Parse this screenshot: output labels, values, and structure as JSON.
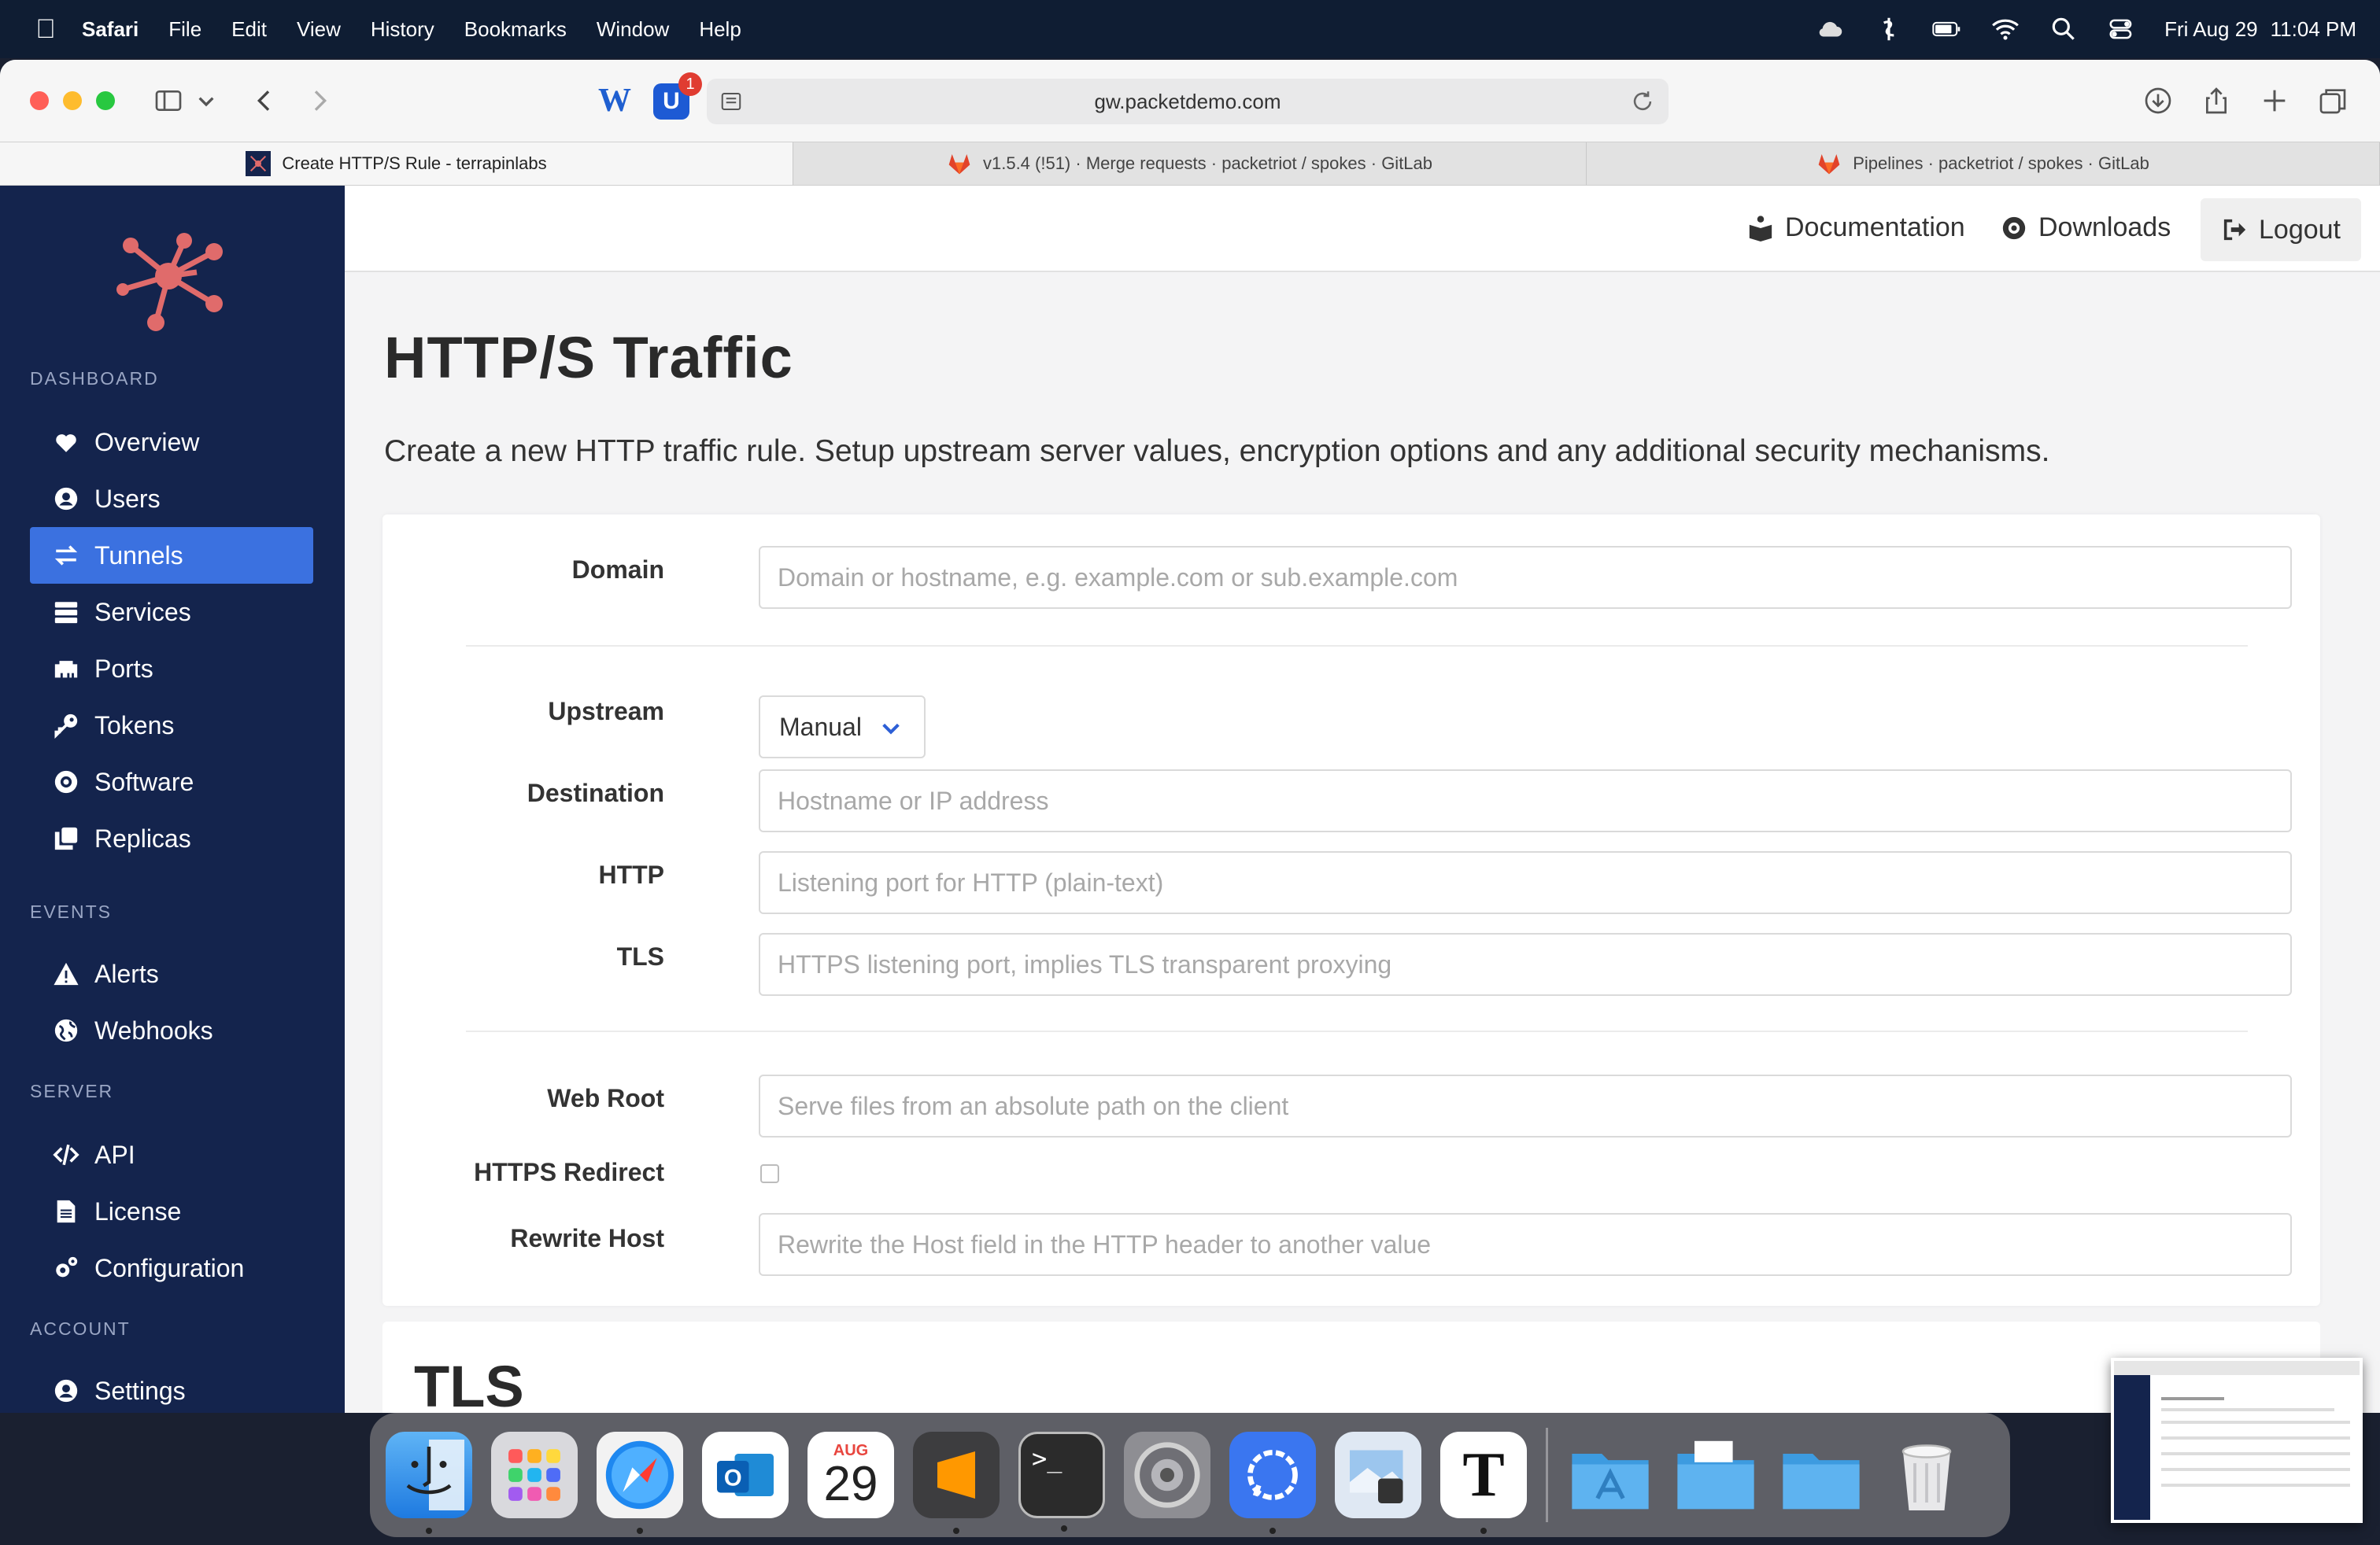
{
  "menubar": {
    "app_name": "Safari",
    "items": [
      "File",
      "Edit",
      "View",
      "History",
      "Bookmarks",
      "Window",
      "Help"
    ],
    "date": "Fri Aug 29",
    "time": "11:04 PM"
  },
  "browser": {
    "url": "gw.packetdemo.com",
    "extension_badge": "1",
    "extension_w": "W",
    "extension_b": "U",
    "tabs": [
      {
        "title": "Create HTTP/S Rule - terrapinlabs",
        "active": true
      },
      {
        "title": "v1.5.4 (!51) · Merge requests · packetriot / spokes · GitLab",
        "active": false
      },
      {
        "title": "Pipelines · packetriot / spokes · GitLab",
        "active": false
      }
    ]
  },
  "sidebar": {
    "sections": {
      "dashboard": "DASHBOARD",
      "events": "EVENTS",
      "server": "SERVER",
      "account": "ACCOUNT"
    },
    "items": [
      {
        "label": "Overview",
        "icon": "heartbeat-icon"
      },
      {
        "label": "Users",
        "icon": "user-circle-icon"
      },
      {
        "label": "Tunnels",
        "icon": "exchange-icon",
        "active": true
      },
      {
        "label": "Services",
        "icon": "server-icon"
      },
      {
        "label": "Ports",
        "icon": "ethernet-icon"
      },
      {
        "label": "Tokens",
        "icon": "key-icon"
      },
      {
        "label": "Software",
        "icon": "disc-icon"
      },
      {
        "label": "Replicas",
        "icon": "clone-icon"
      },
      {
        "label": "Alerts",
        "icon": "warning-icon"
      },
      {
        "label": "Webhooks",
        "icon": "globe-icon"
      },
      {
        "label": "API",
        "icon": "code-icon"
      },
      {
        "label": "License",
        "icon": "file-icon"
      },
      {
        "label": "Configuration",
        "icon": "gears-icon"
      },
      {
        "label": "Settings",
        "icon": "user-circle-icon"
      }
    ]
  },
  "topnav": {
    "documentation": "Documentation",
    "downloads": "Downloads",
    "logout": "Logout"
  },
  "page": {
    "title": "HTTP/S Traffic",
    "description": "Create a new HTTP traffic rule. Setup upstream server values, encryption options and any additional security mechanisms."
  },
  "form": {
    "domain": {
      "label": "Domain",
      "placeholder": "Domain or hostname, e.g. example.com or sub.example.com",
      "value": ""
    },
    "upstream": {
      "label": "Upstream",
      "value": "Manual"
    },
    "destination": {
      "label": "Destination",
      "placeholder": "Hostname or IP address",
      "value": ""
    },
    "http": {
      "label": "HTTP",
      "placeholder": "Listening port for HTTP (plain-text)",
      "value": ""
    },
    "tls": {
      "label": "TLS",
      "placeholder": "HTTPS listening port, implies TLS transparent proxying",
      "value": ""
    },
    "webroot": {
      "label": "Web Root",
      "placeholder": "Serve files from an absolute path on the client",
      "value": ""
    },
    "https_redirect": {
      "label": "HTTPS Redirect",
      "checked": false
    },
    "rewrite_host": {
      "label": "Rewrite Host",
      "placeholder": "Rewrite the Host field in the HTTP header to another value",
      "value": ""
    }
  },
  "next_section": {
    "title": "TLS"
  },
  "dock": {
    "calendar_month": "AUG",
    "calendar_day": "29",
    "apps": [
      "finder-icon",
      "launchpad-icon",
      "safari-icon",
      "outlook-icon",
      "calendar-icon",
      "sublime-icon",
      "terminal-icon",
      "system-settings-icon",
      "signal-icon",
      "preview-icon",
      "typora-icon",
      "applications-folder-icon",
      "folder-icon",
      "folder-icon",
      "trash-icon"
    ]
  },
  "colors": {
    "sidebar_bg": "#14244d",
    "active_nav": "#3b71e0",
    "logo": "#e06b6b"
  }
}
